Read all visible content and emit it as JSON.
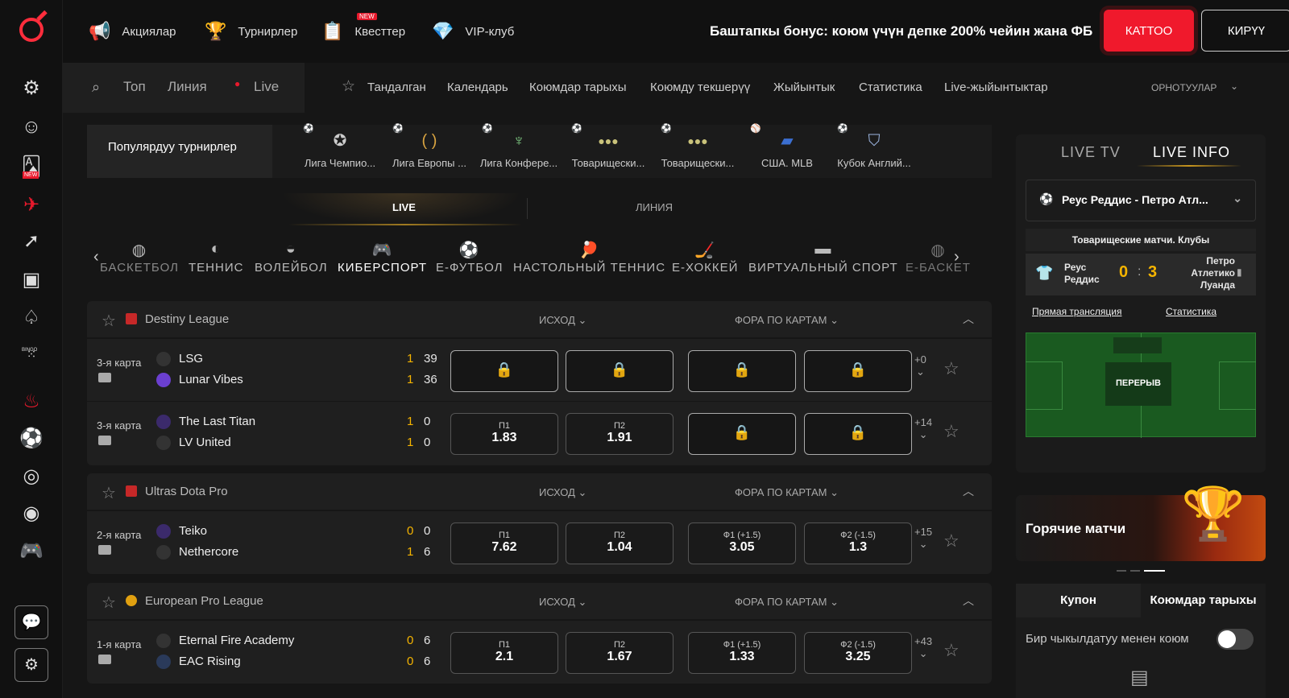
{
  "topnav": {
    "items": [
      {
        "label": "Акциялар",
        "icon": "megaphone-icon"
      },
      {
        "label": "Турнирлер",
        "icon": "trophy-icon"
      },
      {
        "label": "Квесттер",
        "icon": "quest-icon",
        "badge": "NEW"
      },
      {
        "label": "VIP-клуб",
        "icon": "diamond-icon"
      }
    ],
    "bonus_text": "Баштапкы бонус: коюм үчүн депке 200% чейин жана ФБ",
    "register_label": "КАТТОО",
    "login_label": "КИРҮҮ"
  },
  "sidebar": {
    "items": [
      "support-icon",
      "agent-icon",
      "cards-new-icon",
      "plane-icon",
      "rocket-icon",
      "tv-icon",
      "casino-icon",
      "bingo-icon",
      "fire-icon",
      "football-icon",
      "target-icon",
      "nineteen-icon",
      "gamepad-icon"
    ],
    "new_label": "NEW",
    "bingo_label": "BINGO"
  },
  "subnav": {
    "top": "Топ",
    "line": "Линия",
    "live": "Live",
    "items": [
      "Тандалган",
      "Календарь",
      "Коюмдар тарыхы",
      "Коюмду текшерүү",
      "Жыйынтык",
      "Статистика",
      "Live-жыйынтыктар"
    ],
    "settings": "ОРНОТУУЛАР"
  },
  "popular": {
    "title": "Популярдуу турнирлер",
    "items": [
      "Лига Чемпио...",
      "Лига Европы ...",
      "Лига Конфере...",
      "Товарищески...",
      "Товарищески...",
      "США. MLB",
      "Кубок Англий..."
    ]
  },
  "tabs": {
    "live": "LIVE",
    "line": "ЛИНИЯ"
  },
  "sports": [
    "БАСКЕТБОЛ",
    "ТЕННИС",
    "ВОЛЕЙБОЛ",
    "КИБЕРСПОРТ",
    "Е-ФУТБОЛ",
    "НАСТОЛЬНЫЙ ТЕННИС",
    "Е-ХОККЕЙ",
    "ВИРТУАЛЬНЫЙ СПОРТ",
    "Е-БАСКЕТ"
  ],
  "col_outcome": "ИСХОД",
  "col_handicap": "ФОРА ПО КАРТАМ",
  "leagues": [
    {
      "name": "Destiny League",
      "matches": [
        {
          "map": "3-я карта",
          "team1": "LSG",
          "team2": "Lunar Vibes",
          "s1a": "1",
          "s1b": "39",
          "s2a": "1",
          "s2b": "36",
          "odds": [
            {
              "lock": true
            },
            {
              "lock": true
            },
            {
              "lock": true
            },
            {
              "lock": true
            }
          ],
          "more": "+0"
        },
        {
          "map": "3-я карта",
          "team1": "The Last Titan",
          "team2": "LV United",
          "s1a": "1",
          "s1b": "0",
          "s2a": "1",
          "s2b": "0",
          "odds": [
            {
              "label": "П1",
              "value": "1.83"
            },
            {
              "label": "П2",
              "value": "1.91"
            },
            {
              "lock": true
            },
            {
              "lock": true
            }
          ],
          "more": "+14"
        }
      ]
    },
    {
      "name": "Ultras Dota Pro",
      "matches": [
        {
          "map": "2-я карта",
          "team1": "Teiko",
          "team2": "Nethercore",
          "s1a": "0",
          "s1b": "0",
          "s2a": "1",
          "s2b": "6",
          "odds": [
            {
              "label": "П1",
              "value": "7.62"
            },
            {
              "label": "П2",
              "value": "1.04"
            },
            {
              "label": "Ф1 (+1.5)",
              "value": "3.05"
            },
            {
              "label": "Ф2 (-1.5)",
              "value": "1.3"
            }
          ],
          "more": "+15"
        }
      ]
    },
    {
      "name": "European Pro League",
      "matches": [
        {
          "map": "1-я карта",
          "team1": "Eternal Fire Academy",
          "team2": "EAC Rising",
          "s1a": "0",
          "s1b": "6",
          "s2a": "0",
          "s2b": "6",
          "odds": [
            {
              "label": "П1",
              "value": "2.1"
            },
            {
              "label": "П2",
              "value": "1.67"
            },
            {
              "label": "Ф1 (+1.5)",
              "value": "1.33"
            },
            {
              "label": "Ф2 (-1.5)",
              "value": "3.25"
            }
          ],
          "more": "+43"
        }
      ]
    }
  ],
  "right": {
    "tab_tv": "LIVE TV",
    "tab_info": "LIVE INFO",
    "match_title": "Реус Реддис - Петро Атл...",
    "competition": "Товарищеские матчи. Клубы",
    "home": "Реус Реддис",
    "away": "Петро Атлетико Луанда",
    "score_home": "0",
    "score_away": "3",
    "broadcast_link": "Прямая трансляция",
    "stats_link": "Статистика",
    "field_status": "ПЕРЕРЫВ",
    "promo_title": "Горячие матчи",
    "coupon_tab": "Купон",
    "history_tab": "Коюмдар тарыхы",
    "one_click": "Бир чыкылдатуу менен коюм"
  },
  "colors": {
    "accent": "#f5b400",
    "brand": "#f0192c"
  }
}
